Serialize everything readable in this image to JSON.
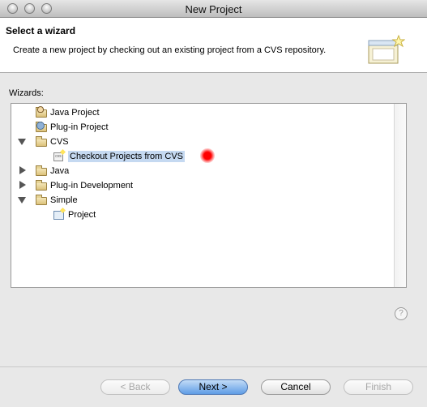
{
  "window": {
    "title": "New Project"
  },
  "header": {
    "title": "Select a wizard",
    "description": "Create a new project by checking out an existing project from a CVS repository."
  },
  "wizards_label": "Wizards:",
  "tree": {
    "items": [
      {
        "label": "Java Project",
        "icon": "java-project-icon"
      },
      {
        "label": "Plug-in Project",
        "icon": "plugin-project-icon"
      },
      {
        "label": "CVS",
        "icon": "folder-open-icon",
        "expanded": true
      },
      {
        "label": "Checkout Projects from CVS",
        "icon": "cvs-checkout-icon",
        "selected": true
      },
      {
        "label": "Java",
        "icon": "folder-icon",
        "expanded": false
      },
      {
        "label": "Plug-in Development",
        "icon": "folder-icon",
        "expanded": false
      },
      {
        "label": "Simple",
        "icon": "folder-open-icon",
        "expanded": true
      },
      {
        "label": "Project",
        "icon": "project-icon"
      }
    ]
  },
  "buttons": {
    "back": "< Back",
    "next": "Next >",
    "cancel": "Cancel",
    "finish": "Finish"
  },
  "help_icon": "?",
  "colors": {
    "selection": "#c5d9f1",
    "default_button": "#5f9de6"
  }
}
